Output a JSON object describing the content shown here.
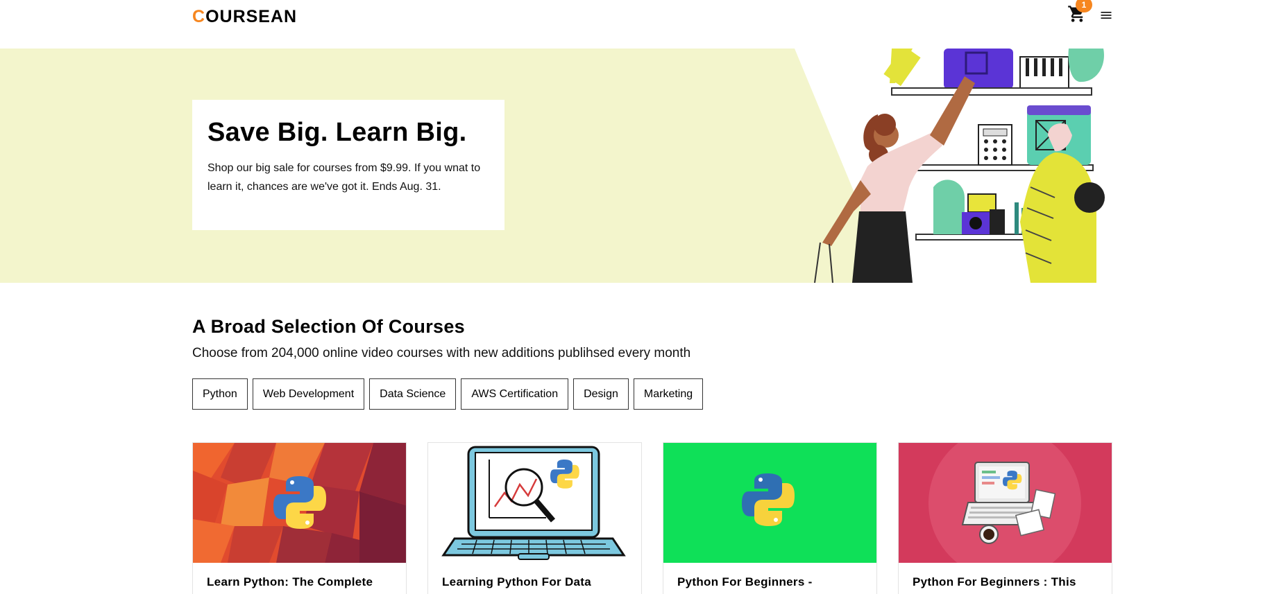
{
  "header": {
    "logo_first": "C",
    "logo_rest": "OURSEAN",
    "cart_count": "1",
    "accent": "#f6861f"
  },
  "hero": {
    "title": "Save Big. Learn Big.",
    "text": "Shop our big sale for courses from $9.99. If you wnat to learn it, chances are we've got it. Ends Aug. 31.",
    "bg": "#f3f5cc"
  },
  "section": {
    "title": "A Broad Selection Of Courses",
    "subtitle": "Choose from 204,000 online video courses with new additions publihsed every month"
  },
  "categories": [
    "Python",
    "Web Development",
    "Data Science",
    "AWS Certification",
    "Design",
    "Marketing"
  ],
  "courses": [
    {
      "title": "Learn Python: The Complete",
      "image": "python-logo-on-red-polygon-background"
    },
    {
      "title": "Learning Python For Data",
      "image": "laptop-with-chart-and-python-logo"
    },
    {
      "title": "Python For Beginners -",
      "image": "python-logo-on-green-background"
    },
    {
      "title": "Python For Beginners : This",
      "image": "laptop-with-python-on-pink-background"
    }
  ],
  "icons": {
    "cart": "shopping-cart-icon",
    "menu": "hamburger-menu-icon"
  }
}
